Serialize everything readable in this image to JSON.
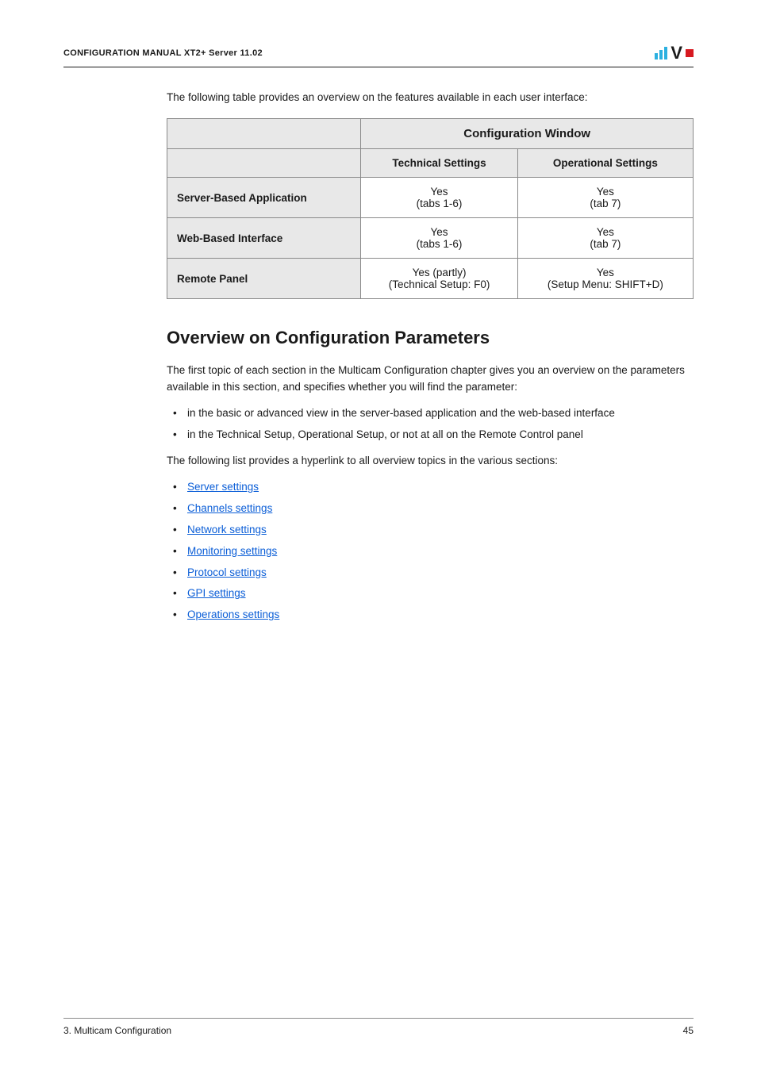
{
  "header": {
    "title": "CONFIGURATION MANUAL  XT2+ Server 11.02"
  },
  "content": {
    "intro": "The following table provides an overview on the features available in each user interface:",
    "table": {
      "config_window": "Configuration Window",
      "tech_settings": "Technical Settings",
      "op_settings": "Operational Settings",
      "rows": [
        {
          "head": "Server-Based Application",
          "tech_l1": "Yes",
          "tech_l2": "(tabs 1-6)",
          "op_l1": "Yes",
          "op_l2": "(tab 7)"
        },
        {
          "head": "Web-Based Interface",
          "tech_l1": "Yes",
          "tech_l2": "(tabs 1-6)",
          "op_l1": "Yes",
          "op_l2": "(tab 7)"
        },
        {
          "head": "Remote Panel",
          "tech_l1": "Yes (partly)",
          "tech_l2": "(Technical Setup: F0)",
          "op_l1": "Yes",
          "op_l2": "(Setup Menu: SHIFT+D)"
        }
      ]
    },
    "section_heading": "Overview on Configuration Parameters",
    "para1": "The first topic of each section in the Multicam Configuration chapter gives you an overview on the parameters available in this section, and specifies whether you will find the parameter:",
    "bullets1": [
      "in the basic or advanced view in the server-based application and the web-based interface",
      "in the Technical Setup, Operational Setup, or not at all on the Remote Control panel"
    ],
    "para2": "The following list provides a hyperlink to all overview topics in the various sections:",
    "links": [
      "Server settings",
      "Channels settings",
      "Network settings",
      "Monitoring settings",
      "Protocol settings",
      "GPI settings",
      "Operations settings"
    ]
  },
  "footer": {
    "left": "3. Multicam Configuration",
    "right": "45"
  }
}
